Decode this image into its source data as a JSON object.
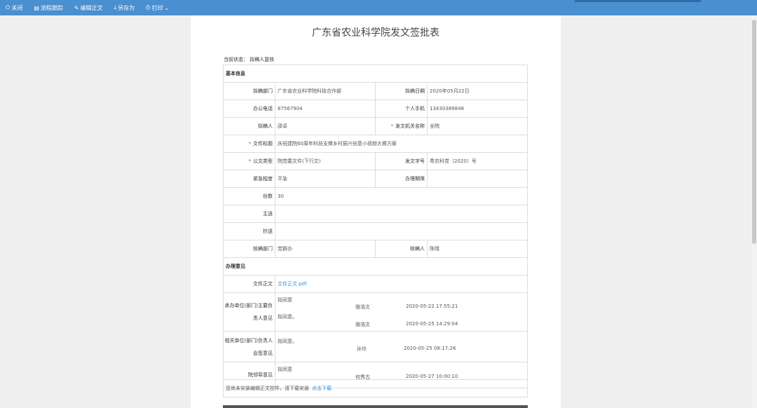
{
  "toolbar": {
    "close": "关闭",
    "flow": "流程跟踪",
    "edit": "编辑正文",
    "saveas": "另存为",
    "print": "打印"
  },
  "title": "广东省农业科学院发文签批表",
  "state": "当前状态：  拟稿人复核",
  "sections": {
    "basic": "基本信息",
    "opinion": "办理意见"
  },
  "fields": {
    "dept_label": "拟稿部门",
    "dept": "广东省农业科学院科技合作部",
    "date_label": "拟稿日期",
    "date": "2020年05月22日",
    "phone_label": "办公电话",
    "phone": "87567904",
    "mobile_label": "个人手机",
    "mobile": "13430389848",
    "drafter_label": "拟稿人",
    "drafter": "邵卓",
    "issuer_label": "发文机关名称",
    "issuer": "全院",
    "subject_label": "文件标题",
    "subject": "庆祝建院60周年科技支撑乡村振兴创意小视频大赛方案",
    "doctype_label": "公文类型",
    "doctype": "院党委文件(下行文)",
    "docno_label": "发文字号",
    "docno": "粤农科党〔2020〕号",
    "urgency_label": "紧急程度",
    "urgency": "平急",
    "deadline_label": "办理期限",
    "deadline": "",
    "copies_label": "份数",
    "copies": "30",
    "main_to_label": "主送",
    "main_to": "",
    "cc_label": "抄送",
    "cc": "",
    "review_dept_label": "核稿部门",
    "review_dept": "党群办",
    "reviewer_label": "核稿人",
    "reviewer": "陈晴"
  },
  "opinions": {
    "doc_label": "文件正文",
    "doc_link": "文件正文.pdf",
    "o1_label_a": "承办单位(部门)主要负",
    "o1_label_b": "责人意见",
    "o1_text1": "拟同意",
    "o1_name1": "骆浩文",
    "o1_time1": "2020-05-22 17:55:21",
    "o1_text2": "拟同意。",
    "o1_name2": "骆浩文",
    "o1_time2": "2020-05-25 14:29:04",
    "o2_label_a": "相关单位(部门)负责人",
    "o2_label_b": "会签意见",
    "o2_text": "拟同意。",
    "o2_name": "孙玲",
    "o2_time": "2020-05-25 08:17:26",
    "o3_label": "院领导意见",
    "o3_text": "拟同意",
    "o3_name": "何秀古",
    "o3_time": "2020-05-27 10:00:10"
  },
  "notice": {
    "text": "您尚未安装编辑正文控件，请下载安装",
    "link": "点击下载"
  }
}
